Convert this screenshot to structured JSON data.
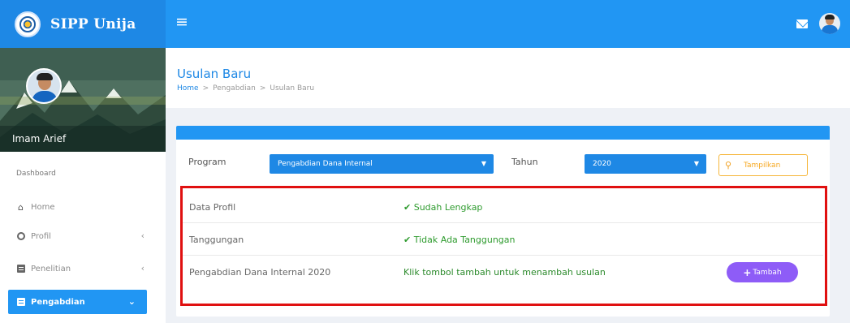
{
  "app": {
    "title": "SIPP Unija"
  },
  "topbar": {
    "menu_icon": "hamburger-icon",
    "mail_icon": "mail-icon",
    "avatar": "user-avatar"
  },
  "sidebar": {
    "user_name": "Imam Arief",
    "heading": "Dashboard",
    "items": [
      {
        "label": "Home",
        "icon": "home-icon",
        "has_chevron": false
      },
      {
        "label": "Profil",
        "icon": "user-circle-icon",
        "has_chevron": true
      },
      {
        "label": "Penelitian",
        "icon": "document-icon",
        "has_chevron": true
      },
      {
        "label": "Pengabdian",
        "icon": "document-icon",
        "has_chevron": true,
        "active": true
      }
    ]
  },
  "header": {
    "title": "Usulan Baru",
    "breadcrumb": [
      "Home",
      "Pengabdian",
      "Usulan Baru"
    ],
    "separator": ">"
  },
  "form": {
    "program_label": "Program",
    "program_value": "Pengabdian Dana Internal",
    "tahun_label": "Tahun",
    "tahun_value": "2020",
    "show_button": "Tampilkan"
  },
  "status_rows": [
    {
      "key": "Data Profil",
      "value": "✔ Sudah Lengkap"
    },
    {
      "key": "Tanggungan",
      "value": "✔ Tidak Ada Tanggungan"
    },
    {
      "key": "Pengabdian Dana Internal 2020",
      "value": "Klik tombol tambah untuk menambah usulan",
      "button": "Tambah"
    }
  ],
  "colors": {
    "primary": "#2196f3",
    "accent_purple": "#8e5cf7",
    "success": "#2e9b2e",
    "highlight_border": "#e01010",
    "warning": "#f6b63a"
  }
}
